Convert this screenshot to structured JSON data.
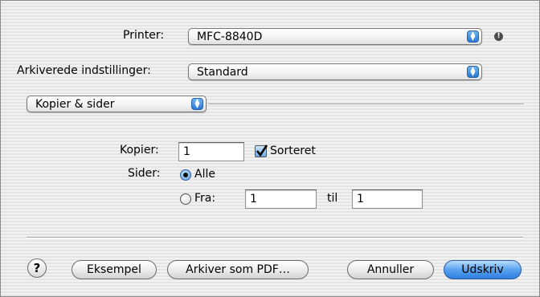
{
  "printer": {
    "label": "Printer:",
    "value": "MFC-8840D",
    "status_icon": "exclamation-icon"
  },
  "presets": {
    "label": "Arkiverede indstillinger:",
    "value": "Standard"
  },
  "panel": {
    "value": "Kopier & sider"
  },
  "copies": {
    "label": "Kopier:",
    "value": "1",
    "collate_label": "Sorteret",
    "collate_checked": true
  },
  "pages": {
    "label": "Sider:",
    "all_label": "Alle",
    "all_selected": true,
    "from_label": "Fra:",
    "from_value": "1",
    "to_label": "til",
    "to_value": "1"
  },
  "buttons": {
    "help": "?",
    "preview": "Eksempel",
    "save_pdf": "Arkiver som PDF…",
    "cancel": "Annuller",
    "print": "Udskriv"
  },
  "colors": {
    "accent": "#3a86e6",
    "background": "#ececec"
  }
}
